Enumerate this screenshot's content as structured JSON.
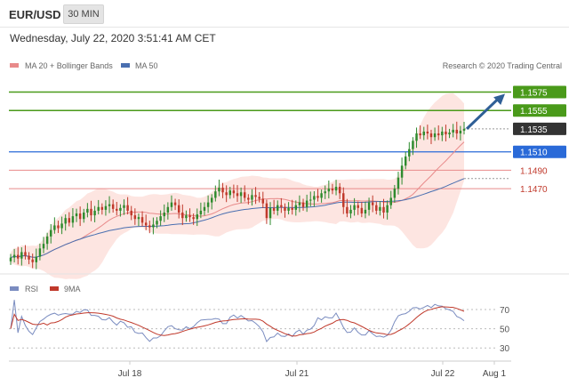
{
  "header": {
    "symbol": "EUR/USD",
    "interval": "30 MIN",
    "datetime": "Wednesday, July 22, 2020 3:51:41 AM CET"
  },
  "colors": {
    "candle_up": "#2e8b2e",
    "candle_down": "#c0392b",
    "ma20": "#e88a8a",
    "ma50": "#4a6fb0",
    "bollinger_fill": "#fde0dc",
    "resistance": "#4a9a1a",
    "support": "#e88a8a",
    "pivot": "#2a6ad8",
    "current": "#333333",
    "rsi": "#7a8cc0",
    "rsi_ma": "#c0392b",
    "arrow": "#2f5f96"
  },
  "chart_data": [
    {
      "type": "candlestick",
      "name": "price",
      "legend": [
        "MA 20 + Bollinger Bands",
        "MA 50"
      ],
      "watermark": "Research © 2020 Trading Central",
      "ylim": [
        1.1385,
        1.159
      ],
      "x_ticks": [
        "Jul 18",
        "Jul 21",
        "Jul 22",
        "Aug 1"
      ],
      "levels": [
        {
          "value": 1.1575,
          "label": "1.1575",
          "kind": "resistance"
        },
        {
          "value": 1.1555,
          "label": "1.1555",
          "kind": "resistance"
        },
        {
          "value": 1.1535,
          "label": "1.1535",
          "kind": "current"
        },
        {
          "value": 1.151,
          "label": "1.1510",
          "kind": "pivot"
        },
        {
          "value": 1.149,
          "label": "1.1490",
          "kind": "support"
        },
        {
          "value": 1.147,
          "label": "1.1470",
          "kind": "support"
        }
      ],
      "close": [
        1.1395,
        1.1398,
        1.1394,
        1.1401,
        1.1397,
        1.1393,
        1.139,
        1.1396,
        1.1405,
        1.141,
        1.1418,
        1.1425,
        1.143,
        1.1427,
        1.1432,
        1.1438,
        1.1433,
        1.144,
        1.1443,
        1.1437,
        1.1444,
        1.1448,
        1.1441,
        1.1446,
        1.145,
        1.1447,
        1.1451,
        1.1453,
        1.1448,
        1.1446,
        1.1449,
        1.1452,
        1.1446,
        1.1441,
        1.1437,
        1.1439,
        1.1433,
        1.143,
        1.1428,
        1.1431,
        1.1435,
        1.144,
        1.1444,
        1.145,
        1.1455,
        1.1452,
        1.1444,
        1.1438,
        1.1441,
        1.1439,
        1.1437,
        1.1442,
        1.1446,
        1.145,
        1.1455,
        1.146,
        1.1467,
        1.1471,
        1.1466,
        1.1463,
        1.1468,
        1.1465,
        1.1462,
        1.1466,
        1.146,
        1.1458,
        1.1463,
        1.1461,
        1.1459,
        1.1454,
        1.1438,
        1.1449,
        1.1446,
        1.1452,
        1.145,
        1.1446,
        1.1449,
        1.1447,
        1.1452,
        1.1455,
        1.145,
        1.1457,
        1.1458,
        1.1462,
        1.146,
        1.1465,
        1.1467,
        1.147,
        1.1468,
        1.1472,
        1.1465,
        1.145,
        1.1443,
        1.1447,
        1.1452,
        1.1449,
        1.1443,
        1.1447,
        1.1455,
        1.1452,
        1.1446,
        1.145,
        1.1444,
        1.1452,
        1.146,
        1.147,
        1.1482,
        1.1495,
        1.1505,
        1.1513,
        1.1522,
        1.153,
        1.1528,
        1.1532,
        1.153,
        1.1526,
        1.153,
        1.1528,
        1.1532,
        1.1529,
        1.1531,
        1.1534,
        1.153,
        1.1533,
        1.1535
      ]
    },
    {
      "type": "line",
      "name": "rsi",
      "legend": [
        "RSI",
        "9MA"
      ],
      "ylim": [
        20,
        82
      ],
      "y_ticks": [
        70,
        50,
        30
      ]
    }
  ]
}
